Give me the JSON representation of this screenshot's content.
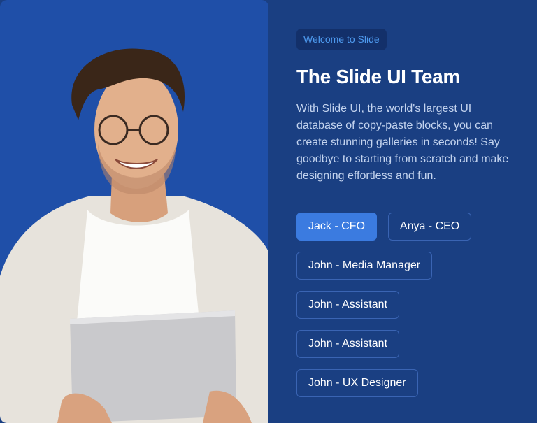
{
  "badge": "Welcome to Slide",
  "title": "The Slide UI Team",
  "description": "With Slide UI, the world's largest UI database of copy-paste blocks, you can create stunning galleries in seconds! Say goodbye to starting from scratch and make designing effortless and fun.",
  "members": [
    {
      "label": "Jack - CFO",
      "active": true
    },
    {
      "label": "Anya - CEO",
      "active": false
    },
    {
      "label": "John - Media Manager",
      "active": false
    },
    {
      "label": "John - Assistant",
      "active": false
    },
    {
      "label": "John - Assistant",
      "active": false
    },
    {
      "label": "John - UX Designer",
      "active": false
    }
  ],
  "colors": {
    "background": "#1a3f82",
    "photo_background": "#1f4fa8",
    "badge_text": "#4e9bf0",
    "active_button": "#3b7be0"
  }
}
